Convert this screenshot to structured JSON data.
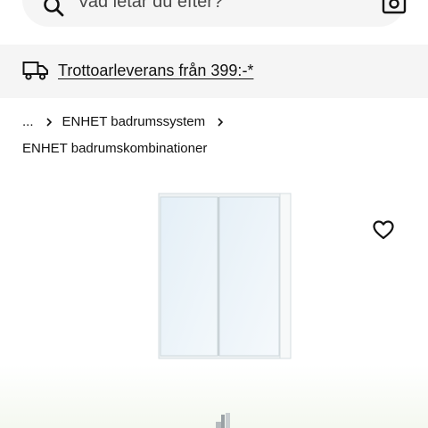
{
  "search": {
    "placeholder": "Vad letar du efter?",
    "icon": "search-icon",
    "camera_icon": "camera-icon"
  },
  "delivery": {
    "icon": "truck-icon",
    "label": "Trottoarleverans från 399:-*"
  },
  "breadcrumb": {
    "items": [
      {
        "label": "..."
      },
      {
        "label": "ENHET badrumssystem"
      }
    ],
    "separator_icon": "chevron-right-icon"
  },
  "category": {
    "label": "ENHET badrumskombinationer"
  },
  "product": {
    "image_subject": "mirror-cabinet",
    "favourite_icon": "heart-icon"
  },
  "colors": {
    "panel_background": "#f5f5f5",
    "text": "#111111",
    "cabinet_frame": "#e9eef0",
    "mirror": "#eef6fb"
  }
}
